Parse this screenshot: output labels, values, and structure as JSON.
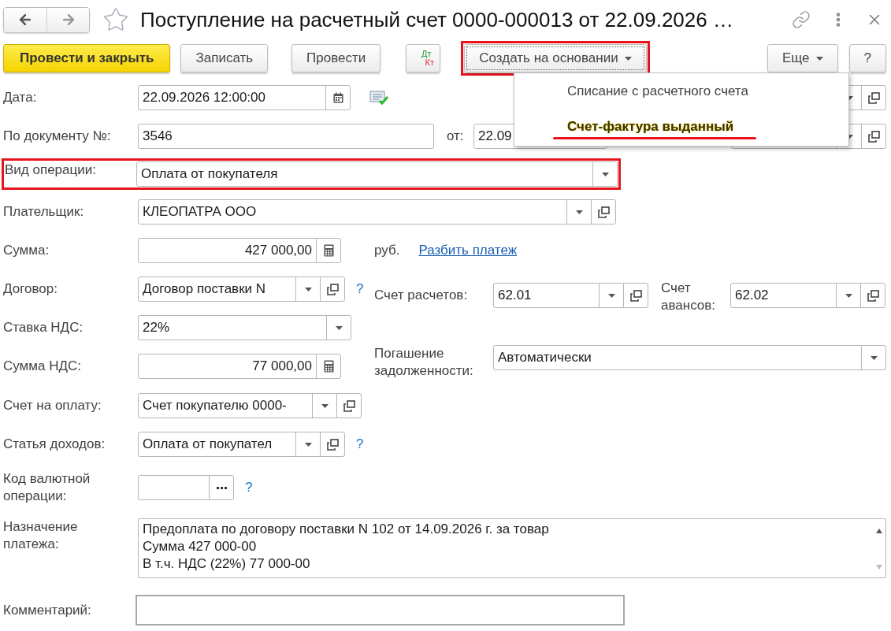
{
  "window": {
    "title": "Поступление на расчетный счет 0000-000013 от 22.09.2026 …",
    "favorite": false
  },
  "toolbar": {
    "buttons": [
      {
        "kind": "primary",
        "label": "Провести и закрыть"
      },
      {
        "kind": "plain",
        "label": "Записать"
      },
      {
        "kind": "plain",
        "label": "Провести"
      },
      {
        "kind": "dtkt",
        "dt": "Дт",
        "kt": "Кт"
      },
      {
        "kind": "menu",
        "label": "Создать на основании",
        "annotated": true,
        "expanded": true
      },
      {
        "kind": "menu",
        "label": "Еще",
        "annotated": false,
        "expanded": false
      },
      {
        "kind": "plain",
        "label": "?"
      }
    ]
  },
  "menu": {
    "items": [
      {
        "label": "Списание с расчетного счета",
        "selected": false,
        "annotated": false
      },
      {
        "label": "Счет-фактура выданный",
        "selected": true,
        "annotated": true
      }
    ]
  },
  "fields": {
    "date": {
      "label": "Дата:",
      "value": "22.09.2026 12:00:00"
    },
    "doc_number": {
      "label": "По документу №:",
      "value": "3546",
      "date_label": "от:",
      "date_value": "22.09"
    },
    "operation": {
      "label": "Вид операции:",
      "value": "Оплата от покупателя",
      "annotated": true
    },
    "payer": {
      "label": "Плательщик:",
      "value": "КЛЕОПАТРА ООО"
    },
    "amount": {
      "label": "Сумма:",
      "value": "427 000,00",
      "currency": "руб.",
      "link": "Разбить платеж"
    },
    "contract": {
      "label": "Договор:",
      "value": "Договор поставки N",
      "help": "?"
    },
    "settlement_account": {
      "label": "Счет расчетов:",
      "value": "62.01"
    },
    "advance_account": {
      "label": "Счет авансов:",
      "value": "62.02"
    },
    "vat_rate": {
      "label": "Ставка НДС:",
      "value": "22%"
    },
    "debt_repayment": {
      "label": "Погашение задолженности:",
      "value": "Автоматически"
    },
    "vat_amount": {
      "label": "Сумма НДС:",
      "value": "77 000,00"
    },
    "invoice": {
      "label": "Счет на оплату:",
      "value": "Счет покупателю 0000-"
    },
    "income_item": {
      "label": "Статья доходов:",
      "value": "Оплата от покупател",
      "help": "?"
    },
    "currency_code": {
      "label": "Код валютной операции:",
      "help": "?"
    },
    "purpose": {
      "label": "Назначение платежа:",
      "lines": [
        "Предоплата по договору поставки N 102 от 14.09.2026 г. за товар",
        "Сумма 427 000-00",
        "В т.ч. НДС (22%) 77 000-00"
      ]
    },
    "comment": {
      "label": "Комментарий:"
    }
  }
}
